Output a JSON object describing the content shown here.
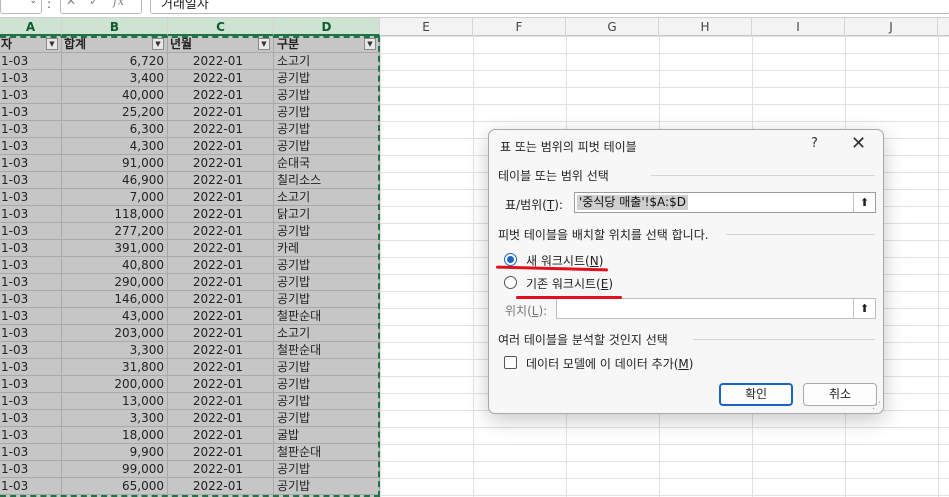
{
  "formula_bar": {
    "name_box_chevron": "⌄",
    "separator": ":",
    "cancel": "✕",
    "enter": "✓",
    "fx": "fx",
    "content": "거래일자"
  },
  "columns": [
    {
      "letter": "A"
    },
    {
      "letter": "B"
    },
    {
      "letter": "C"
    },
    {
      "letter": "D"
    },
    {
      "letter": "E"
    },
    {
      "letter": "F"
    },
    {
      "letter": "G"
    },
    {
      "letter": "H"
    },
    {
      "letter": "I"
    },
    {
      "letter": "J"
    }
  ],
  "table": {
    "headers": [
      "자",
      "합계",
      "년월",
      "구분"
    ],
    "filter_icon": "▼",
    "rows": [
      [
        "1-03",
        "6,720",
        "2022-01",
        "소고기"
      ],
      [
        "1-03",
        "3,400",
        "2022-01",
        "공기밥"
      ],
      [
        "1-03",
        "40,000",
        "2022-01",
        "공기밥"
      ],
      [
        "1-03",
        "25,200",
        "2022-01",
        "공기밥"
      ],
      [
        "1-03",
        "6,300",
        "2022-01",
        "공기밥"
      ],
      [
        "1-03",
        "4,300",
        "2022-01",
        "공기밥"
      ],
      [
        "1-03",
        "91,000",
        "2022-01",
        "순대국"
      ],
      [
        "1-03",
        "46,900",
        "2022-01",
        "칠리소스"
      ],
      [
        "1-03",
        "7,000",
        "2022-01",
        "소고기"
      ],
      [
        "1-03",
        "118,000",
        "2022-01",
        "닭고기"
      ],
      [
        "1-03",
        "277,200",
        "2022-01",
        "공기밥"
      ],
      [
        "1-03",
        "391,000",
        "2022-01",
        "카레"
      ],
      [
        "1-03",
        "40,800",
        "2022-01",
        "공기밥"
      ],
      [
        "1-03",
        "290,000",
        "2022-01",
        "공기밥"
      ],
      [
        "1-03",
        "146,000",
        "2022-01",
        "공기밥"
      ],
      [
        "1-03",
        "43,000",
        "2022-01",
        "철판순대"
      ],
      [
        "1-03",
        "203,000",
        "2022-01",
        "소고기"
      ],
      [
        "1-03",
        "3,300",
        "2022-01",
        "철판순대"
      ],
      [
        "1-03",
        "31,800",
        "2022-01",
        "공기밥"
      ],
      [
        "1-03",
        "200,000",
        "2022-01",
        "공기밥"
      ],
      [
        "1-03",
        "13,000",
        "2022-01",
        "공기밥"
      ],
      [
        "1-03",
        "3,300",
        "2022-01",
        "공기밥"
      ],
      [
        "1-03",
        "18,000",
        "2022-01",
        "굴밥"
      ],
      [
        "1-03",
        "9,900",
        "2022-01",
        "철판순대"
      ],
      [
        "1-03",
        "99,000",
        "2022-01",
        "공기밥"
      ],
      [
        "1-03",
        "65,000",
        "2022-01",
        "공기밥"
      ]
    ]
  },
  "dialog": {
    "title": "표 또는 범위의 피벗 테이블",
    "help": "?",
    "close": "✕",
    "section1": "테이블 또는 범위 선택",
    "range_label": "표/범위(",
    "range_key": "T",
    "range_label_end": "):",
    "range_value": "'중식당 매출'!$A:$D",
    "section2": "피벗 테이블을 배치할 위치를 선택 합니다.",
    "option_new_label": "새 워크시트(",
    "option_new_key": "N",
    "option_new_end": ")",
    "option_new_selected": true,
    "option_existing_label": "기존 워크시트(",
    "option_existing_key": "E",
    "option_existing_end": ")",
    "location_label": "위치(",
    "location_key": "L",
    "location_end": "):",
    "location_value": "",
    "section3": "여러 테이블을 분석할 것인지 선택",
    "datamodel_label": "데이터 모델에 이 데이터 추가(",
    "datamodel_key": "M",
    "datamodel_end": ")",
    "datamodel_checked": false,
    "ok": "확인",
    "cancel": "취소",
    "collapse_icon": "⬆"
  },
  "colors": {
    "selection_marquee": "#217346",
    "accent": "#1a64c8",
    "annotation": "#e0101c"
  }
}
